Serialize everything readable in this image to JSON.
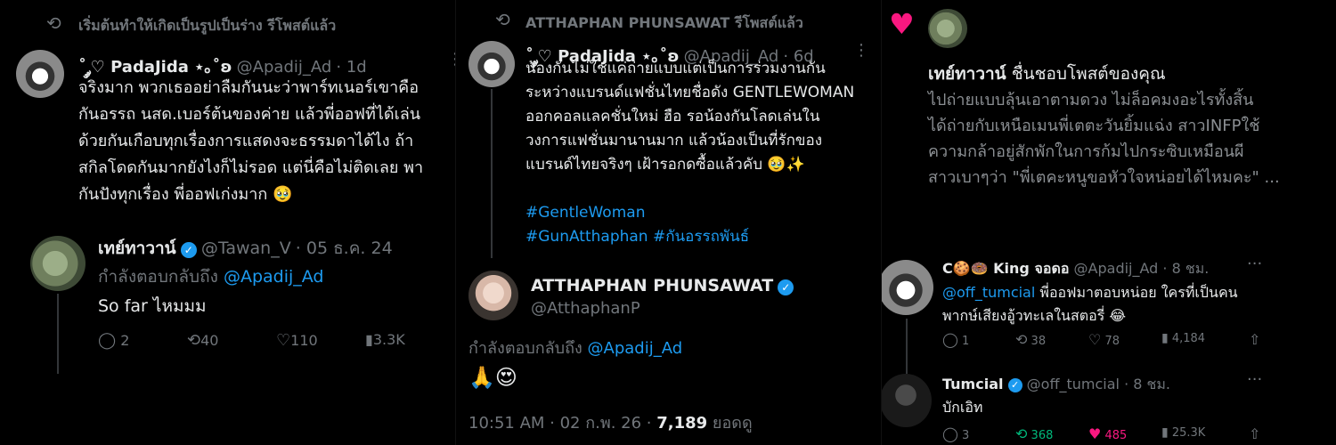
{
  "panel1": {
    "repost_header": "เริ่มต้นทำให้เกิดเป็นรูปเป็นร่าง รีโพสต์แล้ว",
    "tweet": {
      "name": "˚ ༘♡ PadaJida ⋆｡˚ʚ",
      "handle": "@Apadij_Ad",
      "time": "· 1d",
      "lines": [
        "จริงมาก พวกเธออย่าลืมกันนะว่าพาร์ทเนอร์เขาคือ",
        "กันอรรถ นสด.เบอร์ต้นของค่าย แล้วพี่ออฟที่ได้เล่น",
        "ด้วยกันเกือบทุกเรื่องการแสดงจะธรรมดาได้ไง ถ้า",
        "สกิลโดดกันมากยังไงก็ไม่รอด แต่นี่คือไม่ติดเลย พา",
        "กันปังทุกเรื่อง พี่ออฟเก่งมาก 🥹"
      ]
    },
    "reply": {
      "name": "เทย์ทาวาน์",
      "handle": "@Tawan_V",
      "time": "· 05 ธ.ค. 24",
      "replying_prefix": "กำลังตอบกลับถึง",
      "replying_to": "@Apadij_Ad",
      "text": "So far ไหมมม",
      "stats": {
        "replies": "2",
        "reposts": "40",
        "likes": "110",
        "views": "3.3K"
      }
    }
  },
  "panel2": {
    "repost_header": "ATTHAPHAN PHUNSAWAT รีโพสต์แล้ว",
    "tweet": {
      "name": "˚ ༘♡ PadaJida ⋆｡˚ʚ",
      "handle": "@Apadij_Ad",
      "time": "· 6d",
      "lines": [
        "น้องกันไม่ใช่แค่ถ่ายแบบแต่เป็นการร่วมงานกัน",
        "ระหว่างแบรนด์แฟชั่นไทยชื่อดัง GENTLEWOMAN",
        "ออกคอลแลคชั่นใหม่ ฮือ รอน้องกันโลดเล่นใน",
        "วงการแฟชั่นมานานมาก แล้วน้องเป็นที่รักของ",
        "แบรนด์ไทยจริงๆ เฝ้ารอกดซื้อแล้วคับ 🥹✨"
      ],
      "hashtag1": "#GentleWoman",
      "hashtag2": "#GunAtthaphan #กันอรรถพันธ์"
    },
    "reply": {
      "name": "ATTHAPHAN PHUNSAWAT",
      "handle": "@AtthaphanP",
      "replying_prefix": "กำลังตอบกลับถึง",
      "replying_to": "@Apadij_Ad",
      "text": "🙏😍",
      "time": "10:51 AM · 02 ก.พ. 26 ·",
      "views_count": "7,189",
      "views_label": "ยอดดู"
    }
  },
  "panel3": {
    "notification": {
      "name": "เทย์ทาวาน์",
      "action": "ชื่นชอบโพสต์ของคุณ",
      "lines": [
        "ไปถ่ายแบบลุ้นเอาตามดวง ไม่ล็อคมงอะไรทั้งสิ้น",
        "ได้ถ่ายกับเหนือเมนพี่เตตะวันยิ้มแฉ่ง สาวINFPใช้",
        "ความกล้าอยู่สักพักในการก้มไปกระซิบเหมือนผี",
        "สาวเบาๆว่า \"พี่เตคะหนูขอหัวใจหน่อยได้ไหมคะ\" ..."
      ]
    },
    "tweet1": {
      "name": "C🍪🍩 King จอดอ",
      "handle": "@Apadij_Ad",
      "time": "· 8 ชม.",
      "mention": "@off_tumcial",
      "line1": " พี่ออฟมาตอบหน่อย ใครที่เป็นคน",
      "line2": "พากษ์เสียงอู้วทะเลในสตอรี่ 😂",
      "stats": {
        "replies": "1",
        "reposts": "38",
        "likes": "78",
        "views": "4,184"
      }
    },
    "tweet2": {
      "name": "Tumcial",
      "handle": "@off_tumcial",
      "time": "· 8 ชม.",
      "text": "บักเอิท",
      "stats": {
        "replies": "3",
        "reposts": "368",
        "likes": "485",
        "views": "25.3K"
      }
    }
  },
  "colors": {
    "background": "#000000",
    "accent": "#1d9bf0",
    "muted": "#71767b",
    "like": "#f91880",
    "repost": "#00ba7c"
  },
  "icons": [
    "repost-icon",
    "more-icon",
    "reply-icon",
    "like-icon",
    "views-icon",
    "share-icon",
    "verified-icon",
    "heart-icon"
  ]
}
